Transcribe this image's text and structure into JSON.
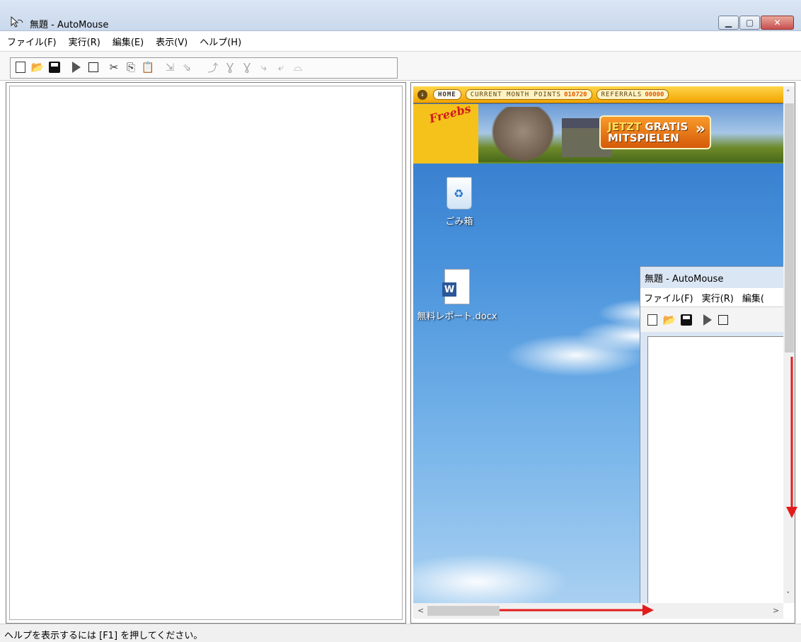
{
  "window": {
    "title": "無題 - AutoMouse",
    "controls": {
      "minimize": "▁",
      "maximize": "▢",
      "close": "✕"
    }
  },
  "menu": [
    "ファイル(F)",
    "実行(R)",
    "編集(E)",
    "表示(V)",
    "ヘルプ(H)"
  ],
  "toolbar": {
    "icons": [
      "new-icon",
      "open-icon",
      "save-icon",
      "play-icon",
      "stop-icon",
      "cut-icon",
      "copy-icon",
      "paste-icon",
      "move-icon",
      "move-rel-icon",
      "click-icon",
      "double-click-icon",
      "triple-click-icon",
      "drag-icon",
      "drop-icon",
      "wheel-icon"
    ]
  },
  "preview": {
    "adbar": {
      "home": "HOME",
      "points_label": "CURRENT MONTH POINTS",
      "points_value": "010720",
      "referrals_label": "REFERRALS",
      "referrals_value": "00000"
    },
    "banner": {
      "logo_text": "Freebs",
      "cta_line1_a": "JETZT",
      "cta_line1_b": "GRATIS",
      "cta_line2": "MITSPIELEN"
    },
    "desktop_icons": [
      "ごみ箱",
      "無料レポート.docx"
    ],
    "nested_window": {
      "title": "無題 - AutoMouse",
      "menu": [
        "ファイル(F)",
        "実行(R)",
        "編集("
      ]
    }
  },
  "statusbar": {
    "text": "ヘルプを表示するには [F1] を押してください。"
  },
  "colors": {
    "annotation": "#e31b1b",
    "titlebar": "#dbe6f4",
    "close": "#c75050"
  }
}
